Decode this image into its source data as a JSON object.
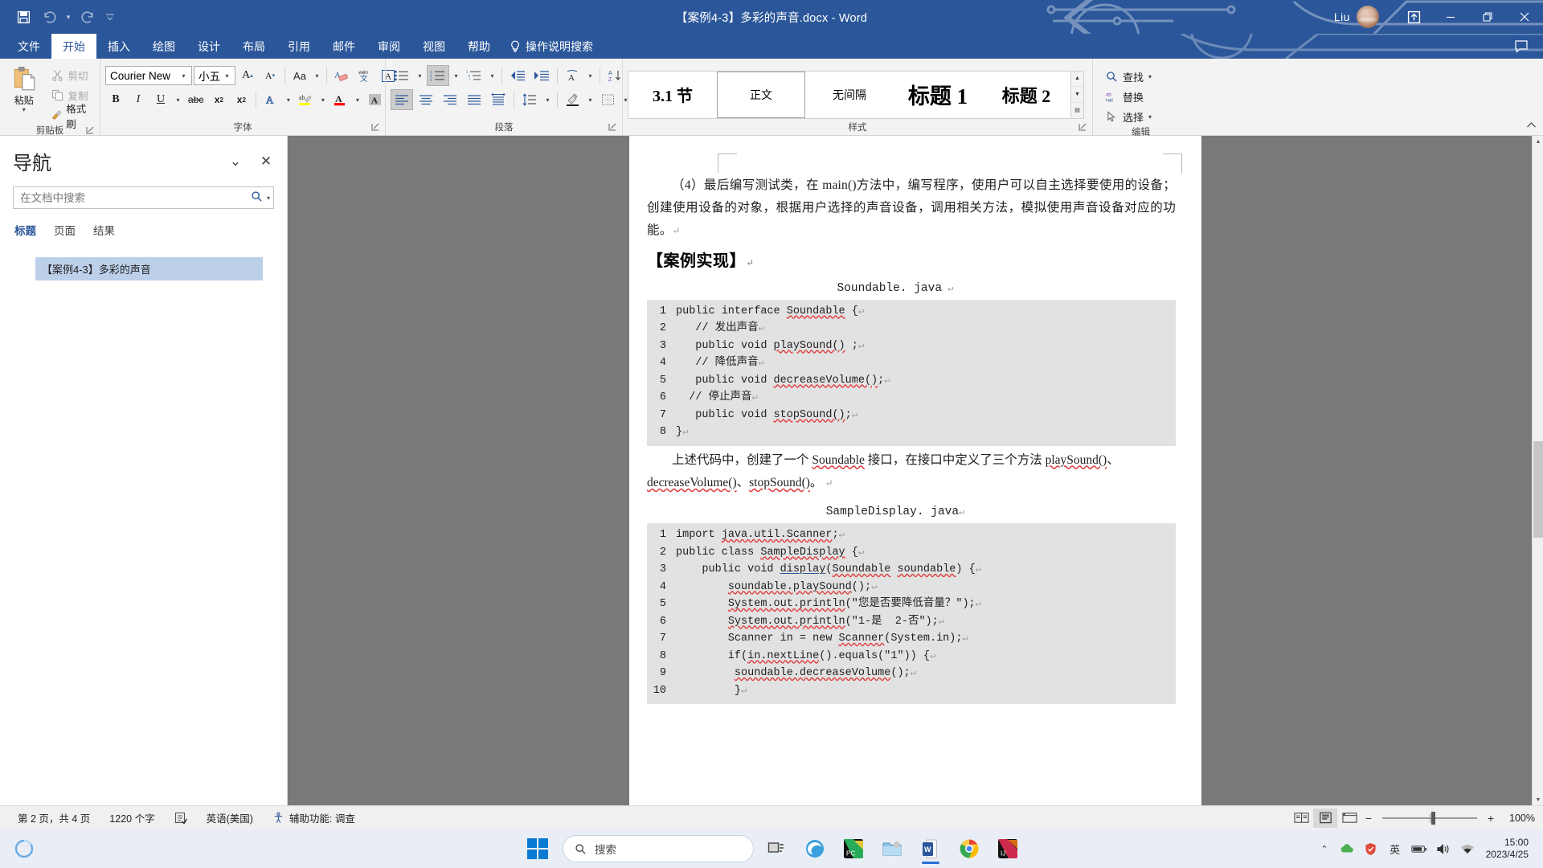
{
  "titlebar": {
    "document_title": "【案例4-3】多彩的声音.docx  -  Word",
    "user_name": "Liu",
    "qat": [
      {
        "name": "save",
        "icon": "save-icon"
      },
      {
        "name": "undo",
        "icon": "undo-icon"
      },
      {
        "name": "redo",
        "icon": "redo-icon"
      },
      {
        "name": "customize",
        "icon": "chevron-down-icon"
      }
    ],
    "ribbon_display_options": "ribbon-display-options-icon",
    "minimize": "minimize-icon",
    "restore": "restore-icon",
    "close": "close-icon",
    "comment_icon": "comment-icon"
  },
  "ribbon_tabs": {
    "tabs": [
      "文件",
      "开始",
      "插入",
      "绘图",
      "设计",
      "布局",
      "引用",
      "邮件",
      "审阅",
      "视图",
      "帮助"
    ],
    "active": "开始",
    "tell_me": "操作说明搜索"
  },
  "ribbon": {
    "clipboard": {
      "label": "剪贴板",
      "paste": "粘贴",
      "cut": "剪切",
      "copy": "复制",
      "format_painter": "格式刷"
    },
    "font": {
      "label": "字体",
      "font_family": "Courier New",
      "font_size": "小五",
      "grow_font": "A",
      "shrink_font": "A",
      "change_case": "Aa",
      "clear_formatting": "clear-formatting-icon",
      "phonetic_guide": "wén 文",
      "character_border": "A"
    },
    "paragraph": {
      "label": "段落",
      "bullets": "bullets-icon",
      "numbering": "numbering-icon",
      "multilevel": "multilevel-list-icon",
      "decrease_indent": "decrease-indent-icon",
      "increase_indent": "increase-indent-icon",
      "sort": "sort-icon",
      "show_marks": "show-formatting-marks-icon",
      "align_left": "align-left-icon",
      "align_center": "align-center-icon",
      "align_right": "align-right-icon",
      "justify": "justify-icon",
      "distribute": "distribute-icon",
      "line_spacing": "line-spacing-icon",
      "shading": "shading-icon",
      "borders": "borders-icon"
    },
    "styles": {
      "label": "样式",
      "items": [
        {
          "name": "3.1 节",
          "selected": false
        },
        {
          "name": "正文",
          "selected": true
        },
        {
          "name": "无间隔",
          "selected": false
        },
        {
          "name": "标题 1",
          "selected": false
        },
        {
          "name": "标题 2",
          "selected": false
        }
      ]
    },
    "editing": {
      "label": "编辑",
      "find": "查找",
      "replace": "替换",
      "select": "选择"
    }
  },
  "navigation": {
    "title": "导航",
    "search_placeholder": "在文档中搜索",
    "search_value": "",
    "tabs": [
      "标题",
      "页面",
      "结果"
    ],
    "active_tab": "标题",
    "headings": [
      {
        "text": "【案例4-3】多彩的声音",
        "selected": true
      }
    ]
  },
  "document": {
    "paragraphs": [
      "（4）最后编写测试类，在 main()方法中，编写程序，使用户可以自主选择要使用的设备；创建使用设备的对象，根据用户选择的声音设备，调用相关方法，模拟使用声音设备对应的功能。"
    ],
    "heading": "【案例实现】",
    "code_block_1": {
      "caption": "Soundable. java",
      "lines": [
        {
          "no": "1",
          "text": "public interface Soundable {"
        },
        {
          "no": "2",
          "text": "   // 发出声音"
        },
        {
          "no": "3",
          "text": "   public void playSound() ;"
        },
        {
          "no": "4",
          "text": "   // 降低声音"
        },
        {
          "no": "5",
          "text": "   public void decreaseVolume();"
        },
        {
          "no": "6",
          "text": "  // 停止声音"
        },
        {
          "no": "7",
          "text": "   public void stopSound();"
        },
        {
          "no": "8",
          "text": "}"
        }
      ]
    },
    "middle_paragraph": "上述代码中，创建了一个 Soundable 接口，在接口中定义了三个方法 playSound()、decreaseVolume()、stopSound()。",
    "code_block_2": {
      "caption": "SampleDisplay. java",
      "lines": [
        {
          "no": "1",
          "text": "import java.util.Scanner;"
        },
        {
          "no": "2",
          "text": "public class SampleDisplay {"
        },
        {
          "no": "3",
          "text": "    public void display(Soundable soundable) {"
        },
        {
          "no": "4",
          "text": "        soundable.playSound();"
        },
        {
          "no": "5",
          "text": "        System.out.println(\"您是否要降低音量？\");"
        },
        {
          "no": "6",
          "text": "        System.out.println(\"1-是  2-否\");"
        },
        {
          "no": "7",
          "text": "        Scanner in = new Scanner(System.in);"
        },
        {
          "no": "8",
          "text": "        if(in.nextLine().equals(\"1\")) {"
        },
        {
          "no": "9",
          "text": "         soundable.decreaseVolume();"
        },
        {
          "no": "10",
          "text": "         }"
        }
      ]
    }
  },
  "statusbar": {
    "page_info": "第 2 页，共 4 页",
    "word_count": "1220 个字",
    "proofing_icon": "proofing-icon",
    "language": "英语(美国)",
    "accessibility": "辅助功能: 调查",
    "view_read": "read-mode-icon",
    "view_print": "print-layout-icon",
    "view_web": "web-layout-icon",
    "zoom_out": "−",
    "zoom_in": "+",
    "zoom_level": "100%"
  },
  "taskbar": {
    "start": "windows-start-icon",
    "search_placeholder": "搜索",
    "items": [
      {
        "name": "task-view",
        "icon": "task-view-icon"
      },
      {
        "name": "edge",
        "icon": "edge-icon"
      },
      {
        "name": "pycharm",
        "icon": "pycharm-icon"
      },
      {
        "name": "app-folder",
        "icon": "folder-icon"
      },
      {
        "name": "word",
        "icon": "word-icon",
        "active": true
      },
      {
        "name": "chrome",
        "icon": "chrome-icon"
      },
      {
        "name": "intellij-idea",
        "icon": "idea-icon"
      }
    ],
    "tray": {
      "hidden_icons": "chevron-up-icon",
      "onedrive": "onedrive-icon",
      "security": "security-icon",
      "ime": "英",
      "battery": "battery-icon",
      "volume": "volume-icon",
      "network": "network-icon"
    },
    "clock_time": "15:00",
    "clock_date": "2023/4/25"
  }
}
